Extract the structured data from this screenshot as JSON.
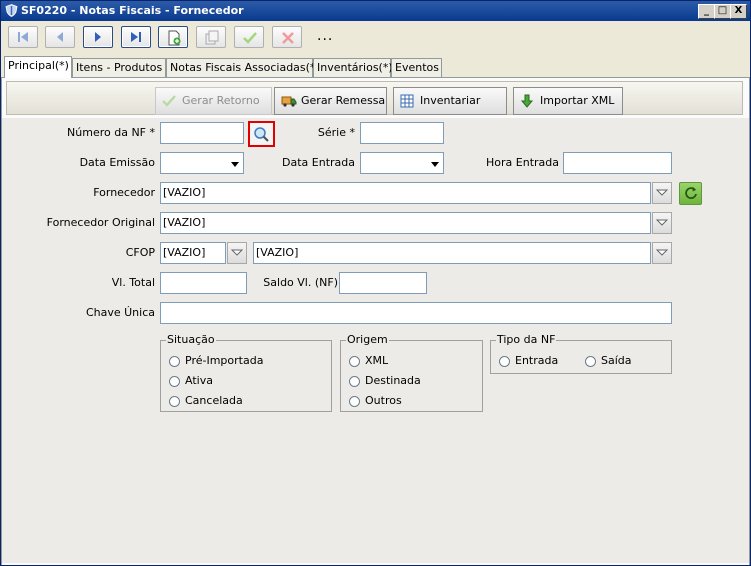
{
  "window": {
    "title": "SF0220 - Notas Fiscais - Fornecedor",
    "minimize": "_",
    "maximize": "□",
    "close": "X"
  },
  "toolbar": {
    "more_label": "..."
  },
  "tabs": [
    {
      "label": "Principal(*)"
    },
    {
      "label": "Itens - Produtos"
    },
    {
      "label": "Notas Fiscais Associadas(*)"
    },
    {
      "label": "Inventários(*)"
    },
    {
      "label": "Eventos"
    }
  ],
  "actions": {
    "gerar_retorno": "Gerar Retorno",
    "gerar_remessa": "Gerar Remessa",
    "inventariar": "Inventariar",
    "importar_xml": "Importar XML"
  },
  "form": {
    "numero_nf_label": "Número da NF *",
    "numero_nf_value": "",
    "serie_label": "Série *",
    "serie_value": "",
    "data_emissao_label": "Data Emissão",
    "data_emissao_value": "",
    "data_entrada_label": "Data Entrada",
    "data_entrada_value": "",
    "hora_entrada_label": "Hora Entrada",
    "hora_entrada_value": "",
    "fornecedor_label": "Fornecedor",
    "fornecedor_value": "[VAZIO]",
    "fornecedor_original_label": "Fornecedor Original",
    "fornecedor_original_value": "[VAZIO]",
    "cfop_label": "CFOP",
    "cfop_code_value": "[VAZIO]",
    "cfop_desc_value": "[VAZIO]",
    "vl_total_label": "Vl. Total",
    "vl_total_value": "",
    "saldo_label": "Saldo Vl. (NF)",
    "saldo_value": "",
    "chave_label": "Chave Única",
    "chave_value": ""
  },
  "situacao": {
    "title": "Situação",
    "options": [
      "Pré-Importada",
      "Ativa",
      "Cancelada"
    ]
  },
  "origem": {
    "title": "Origem",
    "options": [
      "XML",
      "Destinada",
      "Outros"
    ]
  },
  "tipo_nf": {
    "title": "Tipo da NF",
    "options": [
      "Entrada",
      "Saída"
    ]
  },
  "colors": {
    "highlight": "#e00000",
    "title_bar": "#0a3a8e",
    "form_bg": "#ecebe7"
  }
}
